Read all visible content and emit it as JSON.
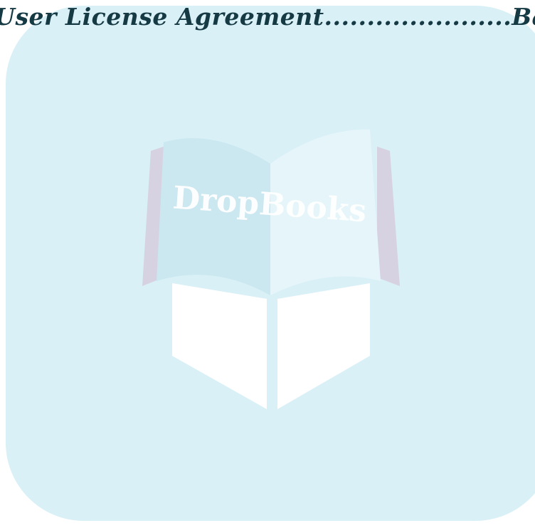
{
  "toc": {
    "entry_title": "-User License Agreement",
    "leader": "......................",
    "page_ref": "Back"
  },
  "watermark": {
    "logo_text": "DropBooks",
    "icon": "open-book-icon",
    "colors": {
      "panel": "#d9f0f7",
      "book_left": "#cbe7f0",
      "book_right": "#e6f5fa",
      "cover_back": "#d6d2e2",
      "shadow": "#ffffff",
      "text_fill": "#ffffff"
    }
  }
}
